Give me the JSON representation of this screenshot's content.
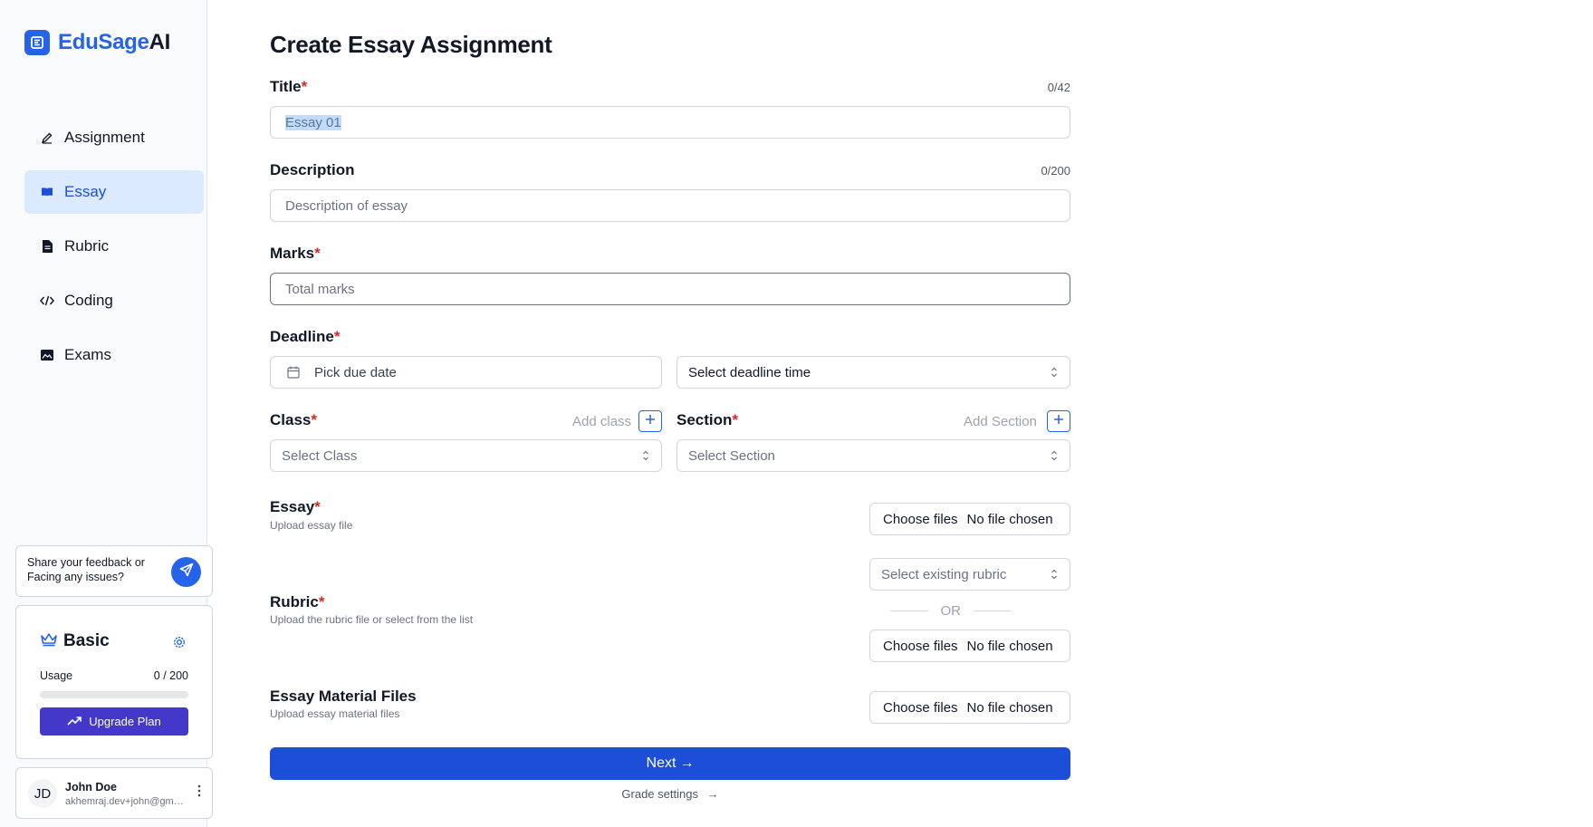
{
  "brand": {
    "name_part1": "EduSage",
    "name_part2": "AI"
  },
  "sidebar": {
    "items": [
      {
        "label": "Assignment",
        "icon": "pencil-icon"
      },
      {
        "label": "Essay",
        "icon": "book-open-icon",
        "active": true
      },
      {
        "label": "Rubric",
        "icon": "file-text-icon"
      },
      {
        "label": "Coding",
        "icon": "code-icon"
      },
      {
        "label": "Exams",
        "icon": "image-icon"
      }
    ],
    "feedback_text": "Share your feedback or Facing any issues?",
    "plan": {
      "name": "Basic",
      "usage_label": "Usage",
      "usage_value": "0 / 200",
      "usage_fraction": 0,
      "upgrade_label": "Upgrade Plan"
    },
    "user": {
      "initials": "JD",
      "name": "John Doe",
      "email": "akhemraj.dev+john@gmail.com"
    }
  },
  "form": {
    "title": "Create Essay Assignment",
    "title_field": {
      "label": "Title",
      "required_mark": "*",
      "counter": "0/42",
      "value": "Essay 01"
    },
    "description": {
      "label": "Description",
      "counter": "0/200",
      "placeholder": "Description of essay"
    },
    "marks": {
      "label": "Marks",
      "required_mark": "*",
      "placeholder": "Total marks"
    },
    "deadline": {
      "label": "Deadline",
      "required_mark": "*",
      "date_placeholder": "Pick due date",
      "time_placeholder": "Select deadline time"
    },
    "class": {
      "label": "Class",
      "required_mark": "*",
      "add_label": "Add class",
      "placeholder": "Select Class"
    },
    "section": {
      "label": "Section",
      "required_mark": "*",
      "add_label": "Add Section",
      "placeholder": "Select Section"
    },
    "essay": {
      "label": "Essay",
      "required_mark": "*",
      "sub": "Upload essay file",
      "choose": "Choose files",
      "status": "No file chosen"
    },
    "rubric": {
      "label": "Rubric",
      "required_mark": "*",
      "sub": "Upload the rubric file or select from the list",
      "select_placeholder": "Select existing rubric",
      "or": "OR",
      "choose": "Choose files",
      "status": "No file chosen"
    },
    "material": {
      "label": "Essay Material Files",
      "sub": "Upload essay material files",
      "choose": "Choose files",
      "status": "No file chosen"
    },
    "next_label": "Next",
    "next_arrow": "→",
    "grade_settings_label": "Grade settings",
    "grade_arrow": "→"
  },
  "colors": {
    "accent": "#2563eb",
    "required": "#dc2626",
    "active_bg": "#dbeafe",
    "upgrade": "#4338ca"
  }
}
